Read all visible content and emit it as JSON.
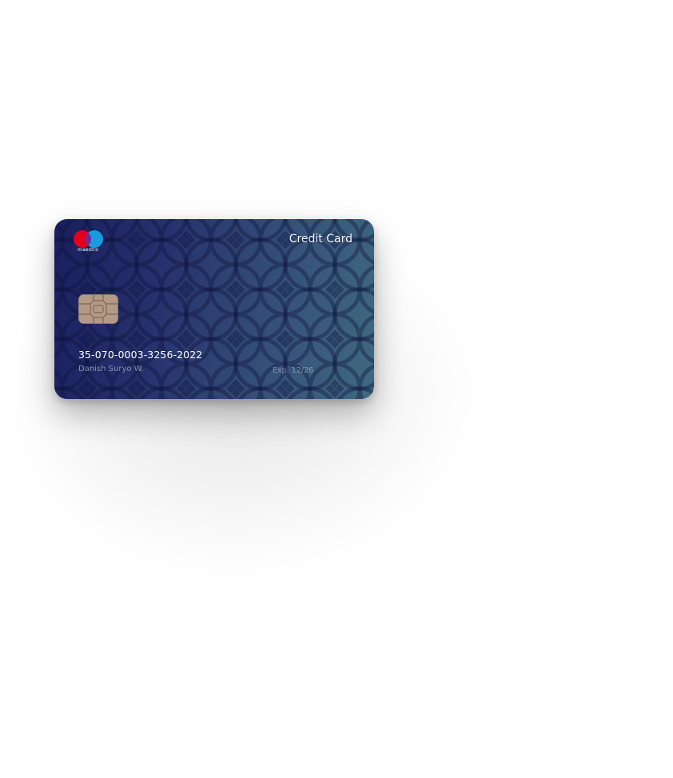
{
  "card": {
    "brand": "maestro",
    "type_label": "Credit Card",
    "number": "35-070-0003-3256-2022",
    "holder": "Danish Suryo W.",
    "expiry": "Exp. 12/26",
    "colors": {
      "gradient_start": "#1a1f5e",
      "gradient_end": "#3f6a80",
      "logo_red": "#e4001c",
      "logo_blue": "#1a9be0",
      "chip": "#b39a86"
    }
  }
}
